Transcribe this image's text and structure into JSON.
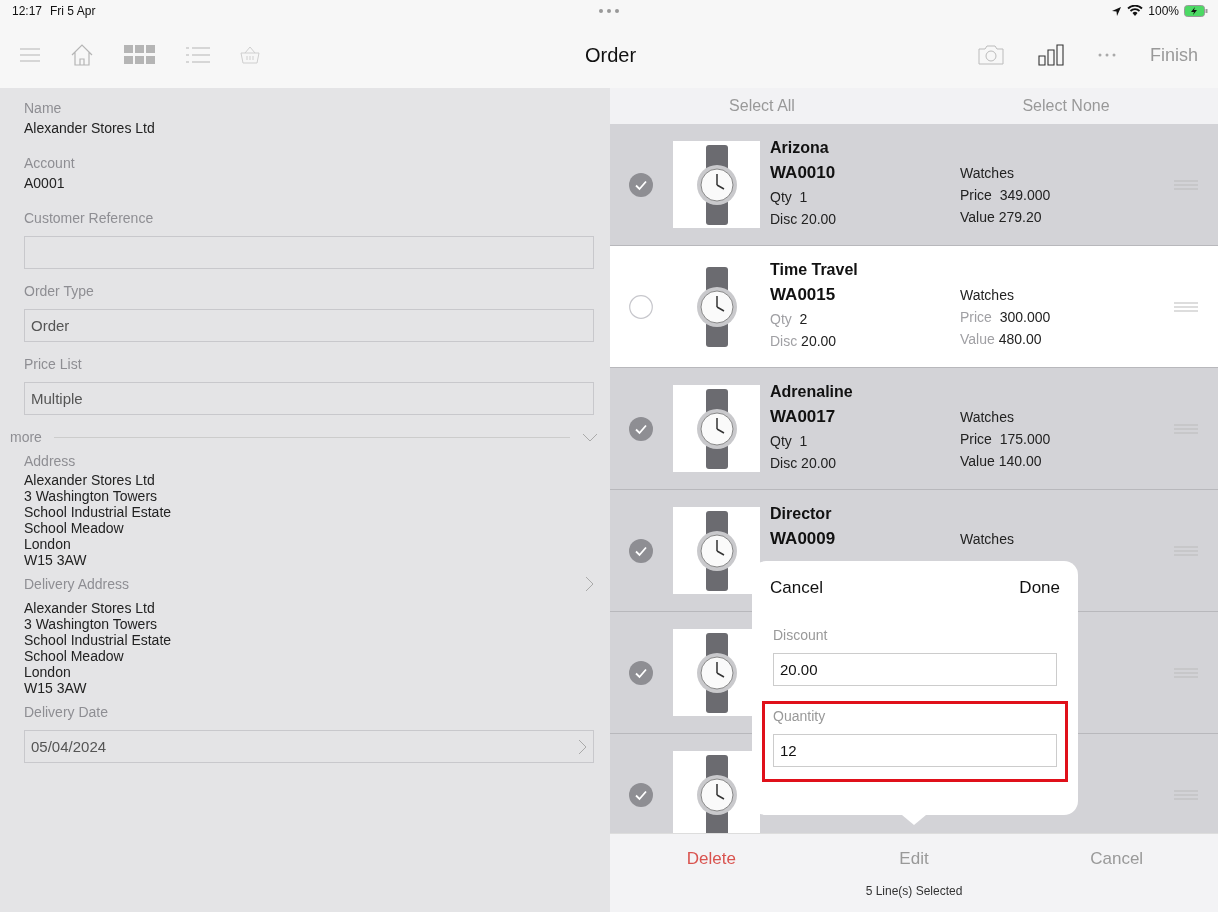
{
  "status_bar": {
    "time": "12:17",
    "date": "Fri 5 Apr",
    "battery": "100%"
  },
  "toolbar": {
    "title": "Order",
    "finish": "Finish"
  },
  "form": [
    {
      "kind": "text",
      "label": "Name",
      "value": "Alexander Stores Ltd"
    },
    {
      "kind": "text",
      "label": "Account",
      "value": "A0001"
    },
    {
      "kind": "input",
      "label": "Customer Reference"
    },
    {
      "kind": "input",
      "label": "Order Type",
      "value": "Order"
    },
    {
      "kind": "input",
      "label": "Price List",
      "value": "Multiple"
    },
    {
      "kind": "section",
      "label": "more"
    },
    {
      "kind": "address",
      "label": "Address",
      "lines": [
        "Alexander Stores Ltd",
        "3 Washington Towers",
        "School Industrial Estate",
        "School Meadow",
        "London",
        "W15 3AW"
      ]
    },
    {
      "kind": "link_address",
      "label": "Delivery Address",
      "lines": [
        "Alexander Stores Ltd",
        "3 Washington Towers",
        "School Industrial Estate",
        "School Meadow",
        "London",
        "W15 3AW"
      ]
    },
    {
      "kind": "date",
      "label": "Delivery Date",
      "value": "05/04/2024"
    }
  ],
  "list_header": {
    "select_all": "Select All",
    "select_none": "Select None"
  },
  "lines": [
    {
      "selected": true,
      "name": "Arizona",
      "code": "WA0010",
      "group": "Watches",
      "qty_label": "Qty",
      "qty": "1",
      "disc_label": "Disc",
      "disc": "20.00",
      "price_label": "Price",
      "price": "349.000",
      "value_label": "Value",
      "value": "279.20"
    },
    {
      "selected": false,
      "name": "Time Travel",
      "code": "WA0015",
      "group": "Watches",
      "qty_label": "Qty",
      "qty": "2",
      "disc_label": "Disc",
      "disc": "20.00",
      "price_label": "Price",
      "price": "300.000",
      "value_label": "Value",
      "value": "480.00"
    },
    {
      "selected": true,
      "name": "Adrenaline",
      "code": "WA0017",
      "group": "Watches",
      "qty_label": "Qty",
      "qty": "1",
      "disc_label": "Disc",
      "disc": "20.00",
      "price_label": "Price",
      "price": "175.000",
      "value_label": "Value",
      "value": "140.00"
    },
    {
      "selected": true,
      "name": "Director",
      "code": "WA0009",
      "group": "Watches"
    },
    {
      "selected": true
    },
    {
      "selected": true
    }
  ],
  "popover": {
    "cancel": "Cancel",
    "done": "Done",
    "fields": [
      {
        "label": "Discount",
        "value": "20.00",
        "highlighted": false
      },
      {
        "label": "Quantity",
        "value": "12",
        "highlighted": true
      }
    ]
  },
  "actions": {
    "delete": "Delete",
    "edit": "Edit",
    "cancel": "Cancel",
    "selected_count": "5 Line(s) Selected"
  }
}
